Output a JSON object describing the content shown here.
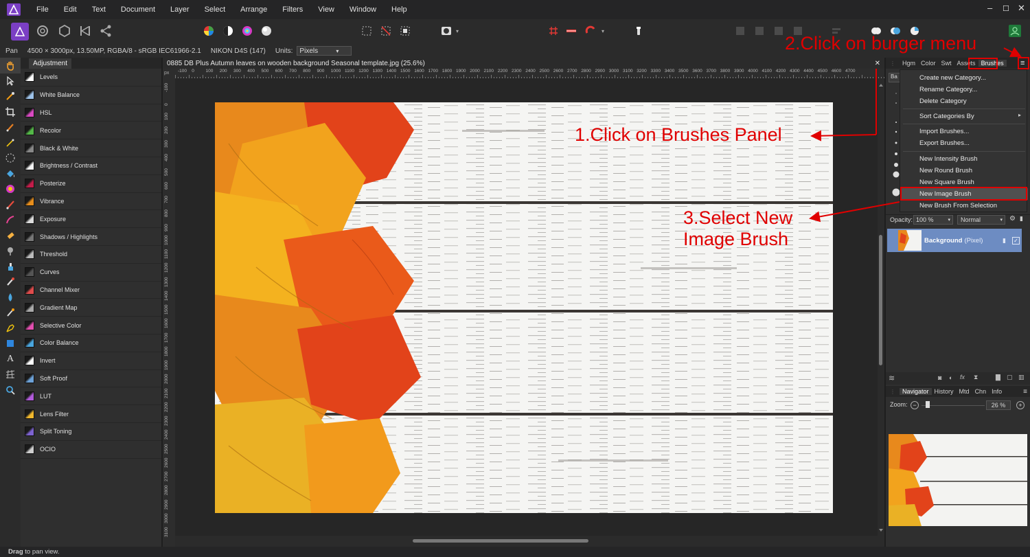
{
  "menubar": {
    "items": [
      "File",
      "Edit",
      "Text",
      "Document",
      "Layer",
      "Select",
      "Arrange",
      "Filters",
      "View",
      "Window",
      "Help"
    ],
    "minimize": "–",
    "maximize": "☐",
    "close": "✕"
  },
  "context": {
    "tool": "Pan",
    "doc_info": "4500 × 3000px, 13.50MP, RGBA/8 - sRGB IEC61966-2.1",
    "camera": "NIKON D4S (147)",
    "units_label": "Units:",
    "units_value": "Pixels"
  },
  "left_panel": {
    "tab": "Adjustment",
    "items": [
      {
        "label": "Levels",
        "icon": "levels-icon",
        "color": "#ffffff"
      },
      {
        "label": "White Balance",
        "icon": "white-balance-icon",
        "color": "#9ec3ea"
      },
      {
        "label": "HSL",
        "icon": "hsl-icon",
        "color": "#d94ac2"
      },
      {
        "label": "Recolor",
        "icon": "recolor-icon",
        "color": "#54b848"
      },
      {
        "label": "Black & White",
        "icon": "black-white-icon",
        "color": "#888888"
      },
      {
        "label": "Brightness / Contrast",
        "icon": "brightness-contrast-icon",
        "color": "#f2f2f2"
      },
      {
        "label": "Posterize",
        "icon": "posterize-icon",
        "color": "#c41d4a"
      },
      {
        "label": "Vibrance",
        "icon": "vibrance-icon",
        "color": "#e88e1c"
      },
      {
        "label": "Exposure",
        "icon": "exposure-icon",
        "color": "#dddddd"
      },
      {
        "label": "Shadows / Highlights",
        "icon": "shadows-highlights-icon",
        "color": "#777777"
      },
      {
        "label": "Threshold",
        "icon": "threshold-icon",
        "color": "#bbbbbb"
      },
      {
        "label": "Curves",
        "icon": "curves-icon",
        "color": "#555555"
      },
      {
        "label": "Channel Mixer",
        "icon": "channel-mixer-icon",
        "color": "#e04c4c"
      },
      {
        "label": "Gradient Map",
        "icon": "gradient-map-icon",
        "color": "#aaaaaa"
      },
      {
        "label": "Selective Color",
        "icon": "selective-color-icon",
        "color": "#e34fb0"
      },
      {
        "label": "Color Balance",
        "icon": "color-balance-icon",
        "color": "#4aa6df"
      },
      {
        "label": "Invert",
        "icon": "invert-icon",
        "color": "#ffffff"
      },
      {
        "label": "Soft Proof",
        "icon": "soft-proof-icon",
        "color": "#6da2d8"
      },
      {
        "label": "LUT",
        "icon": "lut-icon",
        "color": "#b25bdb"
      },
      {
        "label": "Lens Filter",
        "icon": "lens-filter-icon",
        "color": "#f1b82d"
      },
      {
        "label": "Split Toning",
        "icon": "split-toning-icon",
        "color": "#7e63d1"
      },
      {
        "label": "OCIO",
        "icon": "ocio-icon",
        "color": "#cfcfcf"
      }
    ]
  },
  "document": {
    "tab_title": "0885 DB Plus Autumn leaves on wooden background Seasonal template.jpg (25.6%)",
    "ruler_unit": "px",
    "h_ruler_labels": [
      "-100",
      "0",
      "100",
      "200",
      "300",
      "400",
      "500",
      "600",
      "700",
      "800",
      "900",
      "1000",
      "1100",
      "1200",
      "1300",
      "1400",
      "1500",
      "1600",
      "1700",
      "1800",
      "1900",
      "2000",
      "2100",
      "2200",
      "2300",
      "2400",
      "2500",
      "2600",
      "2700",
      "2800",
      "2900",
      "3000",
      "3100",
      "3200",
      "3300",
      "3400",
      "3500",
      "3600",
      "3700",
      "3800",
      "3900",
      "4000",
      "4100",
      "4200",
      "4300",
      "4400",
      "4500",
      "4600",
      "4700"
    ],
    "v_ruler_labels": [
      "-100",
      "0",
      "100",
      "200",
      "300",
      "400",
      "500",
      "600",
      "700",
      "800",
      "900",
      "1000",
      "1100",
      "1200",
      "1300",
      "1400",
      "1500",
      "1600",
      "1700",
      "1800",
      "1900",
      "2000",
      "2100",
      "2200",
      "2300",
      "2400",
      "2500",
      "2600",
      "2700",
      "2800",
      "2900",
      "3000",
      "3100"
    ]
  },
  "right_panel": {
    "tabs": [
      "Hgm",
      "Color",
      "Swt",
      "Assets",
      "Brushes"
    ],
    "active_tab": "Brushes",
    "category_value": "Ba",
    "opacity_label": "Opacity:",
    "opacity_value": "100 %",
    "blend_mode": "Normal",
    "layer_name": "Background",
    "layer_type": "(Pixel)",
    "nav_tabs": [
      "Navigator",
      "History",
      "Mtd",
      "Chn",
      "Info"
    ],
    "zoom_label": "Zoom:",
    "zoom_value": "26 %"
  },
  "burger_menu": {
    "items": [
      "Create new Category...",
      "Rename Category...",
      "Delete Category",
      "Sort Categories By",
      "Import Brushes...",
      "Export Brushes...",
      "New Intensity Brush",
      "New Round Brush",
      "New Square Brush",
      "New Image Brush",
      "New Brush From Selection"
    ],
    "highlighted": "New Image Brush"
  },
  "annotations": {
    "step1": "1.Click on Brushes Panel",
    "step2": "2.Click on burger menu",
    "step3_line1": "3.Select New",
    "step3_line2": "Image Brush",
    "color": "#e00000"
  },
  "status": {
    "bold": "Drag",
    "rest": " to pan view."
  }
}
